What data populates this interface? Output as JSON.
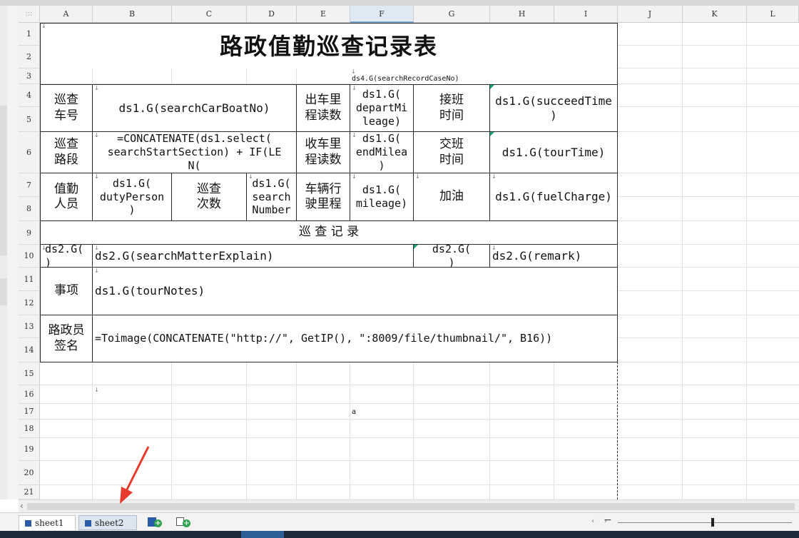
{
  "corner_label": ":::",
  "columns": [
    "A",
    "B",
    "C",
    "D",
    "E",
    "F",
    "G",
    "H",
    "I",
    "J",
    "K",
    "L"
  ],
  "selected_column": "F",
  "rows": [
    "1",
    "2",
    "3",
    "4",
    "5",
    "6",
    "7",
    "8",
    "9",
    "10",
    "11",
    "12",
    "13",
    "14",
    "15",
    "16",
    "17",
    "18",
    "19",
    "20",
    "21"
  ],
  "report": {
    "title": "路政值勤巡查记录表",
    "d3": "ds4.G(searchRecordCaseNo)",
    "a4": "巡查\n车号",
    "b4": "ds1.G(searchCarBoatNo)",
    "e4": "出车里\n程读数",
    "f4": "ds1.G(\ndepartMi\nleage)",
    "g4": "接班\n时间",
    "h4": "ds1.G(succeedTime\n)",
    "a6": "巡查\n路段",
    "b6": "=CONCATENATE(ds1.select(\nsearchStartSection) + IF(LE\nN(",
    "e6": "收车里\n程读数",
    "f6": "ds1.G(\nendMilea\n)",
    "g6": "交班\n时间",
    "h6": "ds1.G(tourTime)",
    "a7": "值勤\n人员",
    "b7": "ds1.G(\ndutyPerson\n)",
    "c7": "巡查\n次数",
    "d7": "ds1.G(\nsearch\nNumber",
    "e7": "车辆行\n驶里程",
    "f7": "ds1.G(\nmileage)",
    "g7": "加油",
    "h7": "ds1.G(fuelCharge)",
    "section": "巡  查  记  录",
    "a10": "ds2.G(\n)",
    "b10": "ds2.G(searchMatterExplain)",
    "g10": "ds2.G(\n)",
    "h10": "ds2.G(remark)",
    "a11": "事项",
    "b11": "ds1.G(tourNotes)",
    "a13": "路政员\n签名",
    "b13": "=Toimage(CONCATENATE(\"http://\", GetIP(), \":8009/file/thumbnail/\", B16))",
    "f17": "a"
  },
  "sheet_tabs": [
    {
      "label": "sheet1",
      "active": true
    },
    {
      "label": "sheet2",
      "active": false
    }
  ],
  "tab_buttons": [
    "add-sheet-icon",
    "add-poly-sheet-icon"
  ],
  "accent_color": "#2b5ca8",
  "annotation_color": "#e8392d"
}
